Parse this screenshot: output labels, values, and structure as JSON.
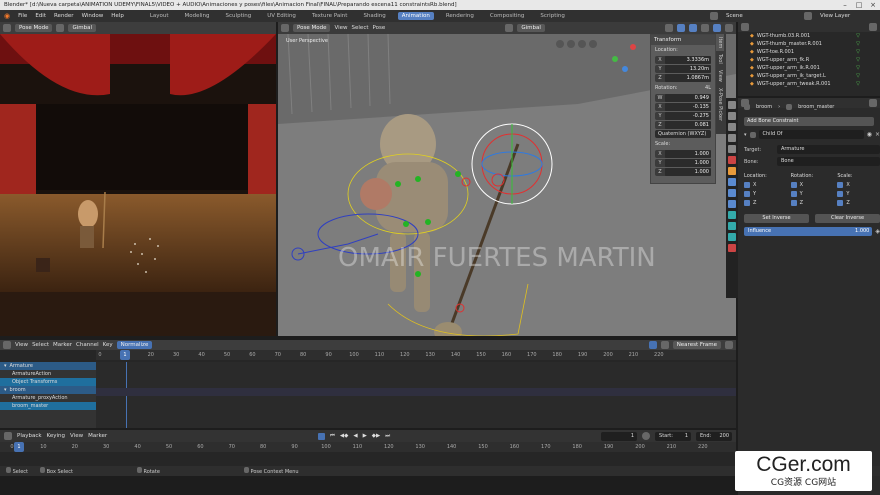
{
  "window": {
    "title": "Blender* [d:\\Nueva carpeta\\ANIMATION UDEMY\\FINAL5\\VIDEO + AUDIO\\Animaciones y poses\\files\\Animacion Final\\FINAL\\Preparando escena11 constraintsRb.blend]"
  },
  "menu": {
    "items": [
      "File",
      "Edit",
      "Render",
      "Window",
      "Help"
    ]
  },
  "workspaces": [
    "Layout",
    "Modeling",
    "Sculpting",
    "UV Editing",
    "Texture Paint",
    "Shading",
    "Animation",
    "Rendering",
    "Compositing",
    "Scripting"
  ],
  "active_workspace": "Animation",
  "scene": {
    "label": "Scene",
    "view_layer": "View Layer"
  },
  "left_view": {
    "mode": "Pose Mode",
    "pivot": "Gimbal"
  },
  "main_view": {
    "mode": "Pose Mode",
    "menus": [
      "View",
      "Select",
      "Pose"
    ],
    "orientation": "Gimbal",
    "overlay_label": "User Perspective",
    "watermark": "OMAIR FUERTES MARTIN"
  },
  "transform_panel": {
    "title": "Transform",
    "location_label": "Location:",
    "location": [
      {
        "axis": "X",
        "value": "3.3336m"
      },
      {
        "axis": "Y",
        "value": "13.20m"
      },
      {
        "axis": "Z",
        "value": "1.0867m"
      }
    ],
    "rotation_label": "Rotation:",
    "rotation_mode_short": "4L",
    "rotation": [
      {
        "axis": "W",
        "value": "0.949"
      },
      {
        "axis": "X",
        "value": "-0.135"
      },
      {
        "axis": "Y",
        "value": "-0.275"
      },
      {
        "axis": "Z",
        "value": "0.081"
      }
    ],
    "rotation_mode": "Quaternion (WXYZ)",
    "scale_label": "Scale:",
    "scale": [
      {
        "axis": "X",
        "value": "1.000"
      },
      {
        "axis": "Y",
        "value": "1.000"
      },
      {
        "axis": "Z",
        "value": "1.000"
      }
    ]
  },
  "side_tabs": [
    "Item",
    "Tool",
    "View",
    "X-Pose Picker"
  ],
  "outliner": {
    "rows": [
      "WGT-thumb.03.R.001",
      "WGT-thumb_master.R.001",
      "WGT-toe.R.001",
      "WGT-upper_arm_fk.R",
      "WGT-upper_arm_ik.R.001",
      "WGT-upper_arm_ik_target.L",
      "WGT-upper_arm_tweak.R.001"
    ]
  },
  "properties": {
    "object": "broom",
    "bone": "broom_master",
    "add_constraint": "Add Bone Constraint",
    "constraint_name": "Child Of",
    "target_label": "Target:",
    "target_value": "Armature",
    "bone_label": "Bone:",
    "bone_value": "Bone",
    "location_label": "Location:",
    "rotation_label": "Rotation:",
    "scale_label": "Scale:",
    "axes": [
      "X",
      "Y",
      "Z"
    ],
    "set_inverse": "Set Inverse",
    "clear_inverse": "Clear Inverse",
    "influence_label": "Influence",
    "influence_value": "1.000"
  },
  "dopesheet": {
    "menus": [
      "View",
      "Select",
      "Marker",
      "Channel",
      "Key"
    ],
    "normalize": "Normalize",
    "snap": "Nearest Frame",
    "channels": [
      {
        "label": "Armature",
        "style": "sel"
      },
      {
        "label": "ArmatureAction",
        "style": ""
      },
      {
        "label": "Object Transforms",
        "style": "blue"
      },
      {
        "label": "broom",
        "style": "sel"
      },
      {
        "label": "Armature_proxyAction",
        "style": ""
      },
      {
        "label": "broom_master",
        "style": "blue"
      }
    ],
    "ruler_ticks": [
      "0",
      "10",
      "20",
      "30",
      "40",
      "50",
      "60",
      "70",
      "80",
      "90",
      "100",
      "110",
      "120",
      "130",
      "140",
      "150",
      "160",
      "170",
      "180",
      "190",
      "200",
      "210",
      "220"
    ],
    "current_frame": "1"
  },
  "playback": {
    "menus": [
      "Playback",
      "Keying",
      "View",
      "Marker"
    ],
    "frame": "1",
    "start_label": "Start:",
    "start": "1",
    "end_label": "End:",
    "end": "200",
    "ruler_ticks": [
      "0",
      "10",
      "20",
      "30",
      "40",
      "50",
      "60",
      "70",
      "80",
      "90",
      "100",
      "110",
      "120",
      "130",
      "140",
      "150",
      "160",
      "170",
      "180",
      "190",
      "200",
      "210",
      "220"
    ]
  },
  "status_bar": {
    "items": [
      "Select",
      "Box Select",
      "Rotate",
      "Pose Context Menu"
    ]
  },
  "watermark_site": {
    "main": "CGer.com",
    "sub": "CG资源 CG网站"
  }
}
